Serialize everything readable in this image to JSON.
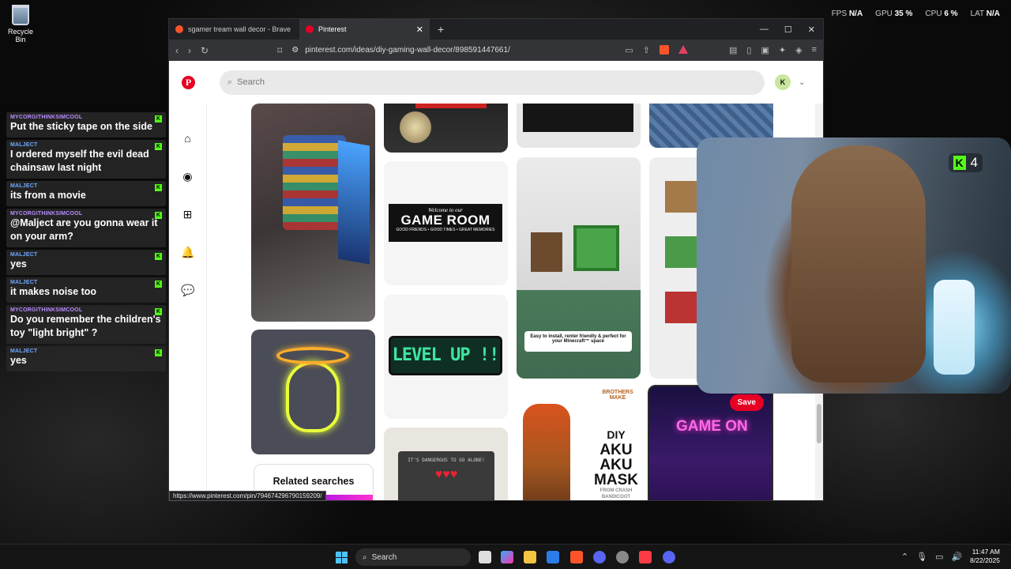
{
  "desktop": {
    "recycle_bin_label": "Recycle Bin"
  },
  "overlay": {
    "fps_label": "FPS",
    "fps_value": "N/A",
    "gpu_label": "GPU",
    "gpu_value": "35 %",
    "cpu_label": "CPU",
    "cpu_value": "6 %",
    "lat_label": "LAT",
    "lat_value": "N/A"
  },
  "chat": {
    "messages": [
      {
        "user": "MYCORGITHINKSIMCOOL",
        "text": "Put the sticky tape on the side"
      },
      {
        "user": "MALJECT",
        "text": "I ordered myself the evil dead chainsaw last night"
      },
      {
        "user": "MALJECT",
        "text": "its from a movie"
      },
      {
        "user": "MYCORGITHINKSIMCOOL",
        "text": "@Malject are you gonna wear it on your arm?"
      },
      {
        "user": "MALJECT",
        "text": "yes"
      },
      {
        "user": "MALJECT",
        "text": "it makes noise too"
      },
      {
        "user": "MYCORGITHINKSIMCOOL",
        "text": "Do you remember the children's toy \"light bright\" ?"
      },
      {
        "user": "MALJECT",
        "text": "yes"
      }
    ]
  },
  "browser": {
    "tabs": [
      {
        "title": "sgamer tream wall decor - Brave Sea"
      },
      {
        "title": "Pinterest"
      }
    ],
    "url_domain": "pinterest.com",
    "url_path": "/ideas/diy-gaming-wall-decor/898591447661/",
    "status_url": "https://www.pinterest.com/pin/794674296790159209/"
  },
  "pinterest": {
    "logo": "P",
    "search_placeholder": "Search",
    "avatar_initial": "K",
    "pins": {
      "game_room_small": "Welcome to our",
      "game_room_big": "GAME ROOM",
      "game_room_sub": "GOOD FRIENDS • GOOD TIMES • GREAT MEMORIES",
      "level_up": "LEVEL UP !!",
      "minecraft_caption": "Easy to install, renter friendly & perfect for your Minecraft™ space",
      "aku_brand": "BROTHERS MAKE",
      "aku_title_1": "DIY",
      "aku_title_2": "AKU",
      "aku_title_3": "AKU",
      "aku_title_4": "MASK",
      "aku_from": "FROM CRASH BANDICOOT",
      "game_on": "GAME ON",
      "save_button": "Save",
      "dangerous_text": "IT'S DANGEROUS TO GO ALONE!",
      "related_searches": "Related searches"
    }
  },
  "webcam": {
    "viewer_count": "4"
  },
  "taskbar": {
    "search_label": "Search",
    "time": "11:47 AM",
    "date": "8/22/2025"
  }
}
